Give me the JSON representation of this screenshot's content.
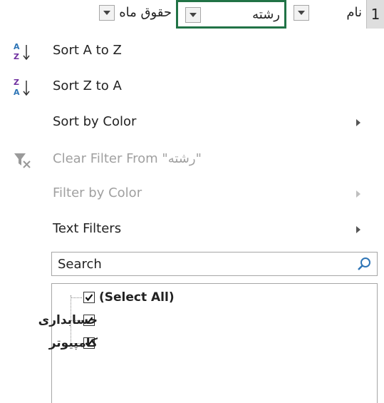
{
  "header": {
    "row_number": "1",
    "col_name_label": "نام",
    "col_major_label": "رشته",
    "col_salary_label": "حقوق ماه"
  },
  "menu": {
    "sort_az": "Sort A to Z",
    "sort_za": "Sort Z to A",
    "sort_by_color": "Sort by Color",
    "clear_filter": "Clear Filter From \"رشته\"",
    "filter_by_color": "Filter by Color",
    "text_filters": "Text Filters"
  },
  "search": {
    "placeholder": "Search"
  },
  "list": {
    "select_all": "(Select All)",
    "items": [
      "حسابداری",
      "کامپیوتر"
    ]
  },
  "colors": {
    "selection_border": "#217346",
    "row_header_bg": "#dedede"
  }
}
